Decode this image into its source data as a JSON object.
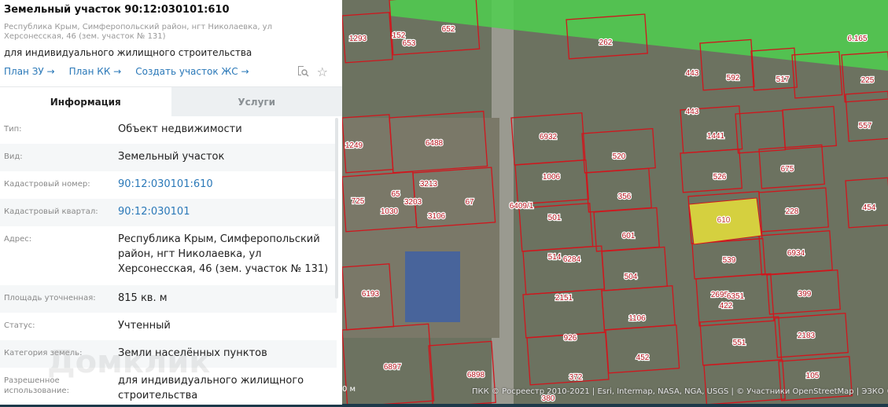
{
  "panel": {
    "title": "Земельный участок 90:12:030101:610",
    "address": "Республика Крым, Симферопольский район, нгт Николаевка, ул Херсонесская, 46 (зем. участок № 131)",
    "purpose": "для индивидуального жилищного строительства",
    "links": [
      "План ЗУ →",
      "План КК →",
      "Создать участок ЖС →"
    ],
    "tabs": {
      "info": "Информация",
      "services": "Услуги"
    },
    "rows": [
      {
        "label": "Тип:",
        "value": "Объект недвижимости"
      },
      {
        "label": "Вид:",
        "value": "Земельный участок"
      },
      {
        "label": "Кадастровый номер:",
        "value": "90:12:030101:610"
      },
      {
        "label": "Кадастровый квартал:",
        "value": "90:12:030101"
      },
      {
        "label": "Адрес:",
        "value": "Республика Крым, Симферопольский район, нгт Николаевка, ул Херсонесская, 46 (зем. участок № 131)"
      },
      {
        "label": "Площадь уточненная:",
        "value": "815 кв. м"
      },
      {
        "label": "Статус:",
        "value": "Учтенный"
      },
      {
        "label": "Категория земель:",
        "value": "Земли населённых пунктов"
      },
      {
        "label": "Разрешенное использование:",
        "value": "для индивидуального жилищного строительства"
      }
    ],
    "watermark": "Домклик"
  },
  "map": {
    "attribution": "ПКК © Росреестр 2010-2021 | Esri, Intermap, NASA, NGA, USGS | © Участники OpenStreetMap | ЭЗКО © Р",
    "scale": "0 м",
    "selected_parcel": "610",
    "parcels": [
      "1293",
      "152",
      "653",
      "652",
      "262",
      "6.165",
      "443",
      "592",
      "517",
      "225",
      "443",
      "1441",
      "557",
      "1249",
      "6488",
      "6932",
      "520",
      "526",
      "675",
      "1006",
      "356",
      "610",
      "228",
      "454",
      "725",
      "1030",
      "3203",
      "65",
      "3213",
      "3106",
      "67",
      "6409/1",
      "501",
      "601",
      "539",
      "6934",
      "514",
      "6284",
      "504",
      "2151",
      "2695",
      "6351",
      "422",
      "399",
      "6193",
      "1106",
      "926",
      "551",
      "2183",
      "452",
      "6897",
      "6898",
      "372",
      "105",
      "380"
    ]
  }
}
